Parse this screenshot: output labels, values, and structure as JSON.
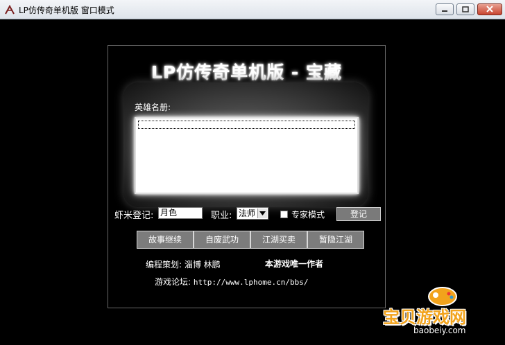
{
  "window": {
    "title": "LP仿传奇单机版 窗口模式"
  },
  "game": {
    "title": "LP仿传奇单机版 - 宝藏",
    "roster_label": "英雄名册:",
    "roster_items": [],
    "name_label": "虾米登记:",
    "name_value": "月色",
    "job_label": "职业:",
    "job_selected": "法师",
    "expert_label": "专家模式",
    "expert_checked": false,
    "login_button": "登记",
    "menu": [
      "故事继续",
      "自废武功",
      "江湖买卖",
      "暂隐江湖"
    ],
    "credits": "编程策划: 淄博 林鹏",
    "credits_extra": "本游戏唯一作者",
    "forum_label": "游戏论坛:",
    "forum_url": "http://www.lphome.cn/bbs/"
  },
  "watermark": {
    "text": "宝贝游戏网",
    "sub": "baobeiy.com"
  },
  "colors": {
    "background": "#000000",
    "text": "#ffffff",
    "button": "#7c7c7c",
    "watermark": "#f2a31c"
  }
}
